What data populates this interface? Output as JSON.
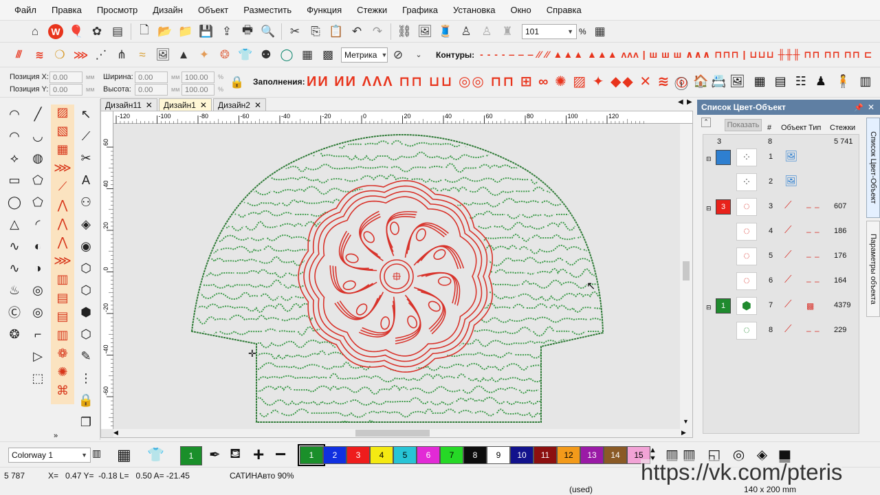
{
  "menu": [
    "Файл",
    "Правка",
    "Просмотр",
    "Дизайн",
    "Объект",
    "Разместить",
    "Функция",
    "Стежки",
    "Графика",
    "Установка",
    "Окно",
    "Справка"
  ],
  "toolbar1": {
    "zoom_value": "101",
    "zoom_unit": "%"
  },
  "toolbar2": {
    "units": "Метрика",
    "contours_label": "Контуры:"
  },
  "toolbar3": {
    "pos_x_label": "Позиция X:",
    "pos_x_value": "0.00",
    "pos_y_label": "Позиция Y:",
    "pos_y_value": "0.00",
    "width_label": "Ширина:",
    "width_value": "0.00",
    "height_label": "Высота:",
    "height_value": "0.00",
    "scale_w": "100.00",
    "scale_h": "100.00",
    "mm": "мм",
    "pct": "%",
    "fills_label": "Заполнения:"
  },
  "tabs": [
    {
      "label": "Дизайн11",
      "active": false
    },
    {
      "label": "Дизайн1",
      "active": true
    },
    {
      "label": "Дизайн2",
      "active": false
    }
  ],
  "ruler": {
    "h_ticks": [
      "-120",
      "-100",
      "-80",
      "-60",
      "-40",
      "-20",
      "0",
      "20",
      "40",
      "60",
      "80",
      "100",
      "120"
    ],
    "v_ticks": [
      "60",
      "40",
      "20",
      "0",
      "-20",
      "-40",
      "-60"
    ]
  },
  "panel": {
    "title": "Список Цвет-Объект",
    "show_button": "Показать",
    "headers": {
      "num": "#",
      "object": "Объект",
      "type": "Тип",
      "stitches": "Стежки"
    },
    "summary": {
      "colors": "3",
      "objects": "8",
      "stitches": "5 741"
    },
    "groups": [
      {
        "color": "#2e7fd0",
        "label": "",
        "kind": "image"
      },
      {
        "color": "#e8221b",
        "label": "3",
        "kind": "color"
      },
      {
        "color": "#1f8a2e",
        "label": "1",
        "kind": "color"
      }
    ],
    "rows": [
      {
        "num": "1",
        "stitches": ""
      },
      {
        "num": "2",
        "stitches": ""
      },
      {
        "num": "3",
        "stitches": "607"
      },
      {
        "num": "4",
        "stitches": "186"
      },
      {
        "num": "5",
        "stitches": "176"
      },
      {
        "num": "6",
        "stitches": "164"
      },
      {
        "num": "7",
        "stitches": "4379"
      },
      {
        "num": "8",
        "stitches": "229"
      }
    ],
    "side_tabs": [
      "Список Цвет-Объект",
      "Параметры объекта"
    ]
  },
  "palette": {
    "colorway": "Colorway 1",
    "current": "1",
    "swatches": [
      {
        "label": "1",
        "color": "#1a8f2a",
        "text": "#ffffff"
      },
      {
        "label": "2",
        "color": "#1030e0",
        "text": "#ffffff"
      },
      {
        "label": "3",
        "color": "#ee1c1c",
        "text": "#ffffff"
      },
      {
        "label": "4",
        "color": "#f5ea12",
        "text": "#000000"
      },
      {
        "label": "5",
        "color": "#28c4d6",
        "text": "#000000"
      },
      {
        "label": "6",
        "color": "#e22ad6",
        "text": "#ffffff"
      },
      {
        "label": "7",
        "color": "#26d826",
        "text": "#000000"
      },
      {
        "label": "8",
        "color": "#0c0c0c",
        "text": "#ffffff"
      },
      {
        "label": "9",
        "color": "#ffffff",
        "text": "#000000"
      },
      {
        "label": "10",
        "color": "#12128c",
        "text": "#ffffff"
      },
      {
        "label": "11",
        "color": "#8c1010",
        "text": "#ffffff"
      },
      {
        "label": "12",
        "color": "#f39a1a",
        "text": "#000000"
      },
      {
        "label": "13",
        "color": "#9a1aa6",
        "text": "#ffffff"
      },
      {
        "label": "14",
        "color": "#8a5a26",
        "text": "#ffffff"
      },
      {
        "label": "15",
        "color": "#f2a3d6",
        "text": "#000000"
      }
    ]
  },
  "status": {
    "count": "5 787",
    "coords": "X=   0.47 Y=  -0.18 L=   0.50 A= -21.45",
    "mode": "САТИНАвто 90%",
    "used": "(used)",
    "size": "140 x 200 mm",
    "watermark": "https://vk.com/pteris"
  },
  "colors": {
    "accent": "#e8341c",
    "stitch_green": "#2e8a3a",
    "stitch_red": "#d8322a"
  }
}
